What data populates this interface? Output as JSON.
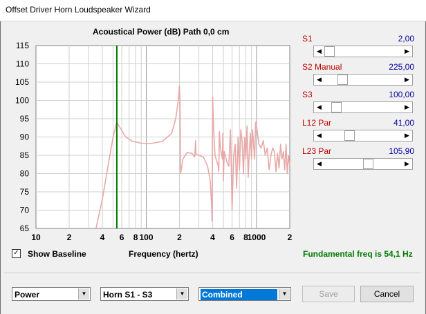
{
  "window": {
    "title": "Offset Driver Horn Loudspeaker Wizard"
  },
  "chart_title": "Acoustical Power (dB)   Path 0,0 cm",
  "chart_data": {
    "type": "line",
    "title": "Acoustical Power (dB)   Path 0,0 cm",
    "xlabel": "Frequency (hertz)",
    "ylabel": "",
    "x_scale": "log",
    "xlim": [
      10,
      2000
    ],
    "ylim": [
      65,
      115
    ],
    "y_ticks": [
      "115",
      "110",
      "105",
      "100",
      "95",
      "90",
      "85",
      "80",
      "75",
      "70",
      "65"
    ],
    "x_ticks": [
      {
        "value": 10,
        "label": "10"
      },
      {
        "value": 20,
        "label": "2"
      },
      {
        "value": 40,
        "label": "4"
      },
      {
        "value": 60,
        "label": "6"
      },
      {
        "value": 80,
        "label": "8"
      },
      {
        "value": 100,
        "label": "100"
      },
      {
        "value": 200,
        "label": "2"
      },
      {
        "value": 400,
        "label": "4"
      },
      {
        "value": 600,
        "label": "6"
      },
      {
        "value": 800,
        "label": "8"
      },
      {
        "value": 1000,
        "label": "1000"
      },
      {
        "value": 2000,
        "label": "2"
      }
    ],
    "grid": true,
    "marker_line": {
      "x": 54.1,
      "color": "#007a00"
    },
    "series": [
      {
        "color": "#e8a8a8",
        "x": [
          35,
          40,
          45,
          50,
          54,
          58,
          65,
          75,
          90,
          110,
          140,
          170,
          185,
          195,
          200,
          202,
          205,
          215,
          235,
          260,
          275,
          280,
          282,
          285,
          300,
          330,
          360,
          380,
          390,
          395,
          400,
          405,
          410,
          415,
          420,
          440,
          450,
          455,
          460,
          470,
          490,
          495,
          500,
          510,
          540,
          560,
          580,
          600,
          620,
          640,
          660,
          680,
          700,
          720,
          740,
          760,
          780,
          800,
          820,
          840,
          860,
          880,
          900,
          920,
          940,
          960,
          980,
          1000,
          1050,
          1100,
          1150,
          1200,
          1250,
          1300,
          1350,
          1400,
          1450,
          1500,
          1550,
          1600,
          1650,
          1700,
          1750,
          1800,
          1850,
          1900,
          1950,
          2000
        ],
        "y": [
          65,
          73,
          82,
          90,
          94,
          92.5,
          90,
          88.8,
          88.3,
          88.2,
          88.8,
          91,
          95,
          100,
          104,
          100,
          80,
          84,
          85.8,
          85.5,
          84.5,
          89,
          85.5,
          85.2,
          85,
          84.5,
          82,
          78,
          72,
          67,
          101,
          95,
          91,
          88,
          85,
          83,
          82,
          80.5,
          91.5,
          87,
          84,
          91,
          78,
          86,
          83,
          82,
          92,
          70,
          85,
          88,
          76,
          90,
          81,
          92,
          89,
          80,
          90,
          84,
          93,
          79,
          86,
          91,
          84,
          92,
          88,
          84,
          94,
          93,
          88,
          87,
          89,
          85,
          87,
          81,
          85,
          87,
          86,
          80.5,
          85.5,
          81.5,
          88,
          84,
          86,
          81,
          88,
          80,
          85,
          82
        ]
      }
    ]
  },
  "sliders": [
    {
      "label": "S1",
      "value": "2,00",
      "position": 0.0
    },
    {
      "label": "S2  Manual",
      "value": "225,00",
      "position": 0.2
    },
    {
      "label": "S3",
      "value": "100,00",
      "position": 0.1
    },
    {
      "label": "L12  Par",
      "value": "41,00",
      "position": 0.3
    },
    {
      "label": "L23  Par",
      "value": "105,90",
      "position": 0.58
    }
  ],
  "show_baseline": {
    "label": "Show Baseline",
    "checked": true,
    "check_glyph": "✓"
  },
  "frequency_label": "Frequency (hertz)",
  "fundamental": "Fundamental freq is 54,1 Hz",
  "combos": [
    {
      "value": "Power"
    },
    {
      "value": "Horn S1 - S3"
    },
    {
      "value": "Combined"
    }
  ],
  "buttons": {
    "save": "Save",
    "cancel": "Cancel"
  }
}
